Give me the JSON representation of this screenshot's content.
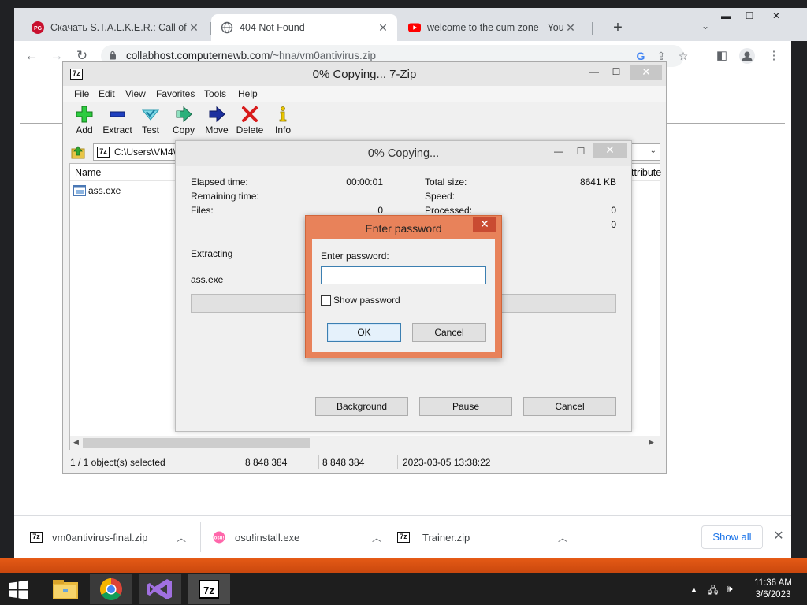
{
  "browser": {
    "tabs": [
      {
        "label": "Скачать S.T.A.L.K.E.R.: Call of Prip",
        "favicon": "pg-logo-icon",
        "active": false
      },
      {
        "label": "404 Not Found",
        "favicon": "globe-icon",
        "active": true
      },
      {
        "label": "welcome to the cum zone - YouT",
        "favicon": "youtube-icon",
        "active": false
      }
    ],
    "url_host": "collabhost.computernewb.com",
    "url_path": "/~hna/vm0antivirus.zip"
  },
  "downloads": {
    "items": [
      {
        "name": "vm0antivirus-final.zip",
        "icon": "7zip-archive-icon"
      },
      {
        "name": "osu!install.exe",
        "icon": "osu-icon"
      },
      {
        "name": "Trainer.zip",
        "icon": "7zip-archive-icon"
      }
    ],
    "show_all_label": "Show all"
  },
  "zip": {
    "title": "0% Copying... 7-Zip",
    "app_icon_text": "7z",
    "menu": [
      "File",
      "Edit",
      "View",
      "Favorites",
      "Tools",
      "Help"
    ],
    "tools": [
      {
        "label": "Add",
        "icon": "add-plus-icon"
      },
      {
        "label": "Extract",
        "icon": "extract-minus-icon"
      },
      {
        "label": "Test",
        "icon": "test-check-icon"
      },
      {
        "label": "Copy",
        "icon": "copy-arrow-icon"
      },
      {
        "label": "Move",
        "icon": "move-arrow-icon"
      },
      {
        "label": "Delete",
        "icon": "delete-x-icon"
      },
      {
        "label": "Info",
        "icon": "info-icon"
      }
    ],
    "path": "C:\\Users\\VM4\\",
    "columns": {
      "name": "Name",
      "attributes": "ttribute"
    },
    "files": [
      {
        "name": "ass.exe"
      }
    ],
    "status": {
      "selected": "1 / 1 object(s) selected",
      "size": "8 848 384",
      "packed": "8 848 384",
      "modified": "2023-03-05 13:38:22"
    }
  },
  "progress": {
    "title": "0% Copying...",
    "elapsed_label": "Elapsed time:",
    "elapsed_value": "00:00:01",
    "remaining_label": "Remaining time:",
    "files_label": "Files:",
    "files_value": "0",
    "total_size_label": "Total size:",
    "total_size_value": "8641 KB",
    "speed_label": "Speed:",
    "processed_label": "Processed:",
    "processed_value": "0",
    "extra_value": "0",
    "action": "Extracting",
    "current_file": "ass.exe",
    "percent": 0,
    "background_label": "Background",
    "pause_label": "Pause",
    "cancel_label": "Cancel"
  },
  "password": {
    "title": "Enter password",
    "label": "Enter password:",
    "value": "",
    "show_password_label": "Show password",
    "show_password_checked": false,
    "ok_label": "OK",
    "cancel_label": "Cancel"
  },
  "taskbar": {
    "apps": [
      "file-explorer-icon",
      "chrome-icon",
      "visual-studio-icon",
      "7zip-icon"
    ],
    "active_app": "7zip-icon",
    "time": "11:36 AM",
    "date": "3/6/2023"
  }
}
